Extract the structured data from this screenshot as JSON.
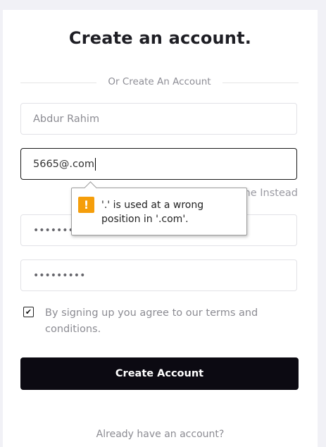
{
  "form": {
    "title": "Create an account.",
    "divider_text": "Or Create An Account",
    "name_value": "Abdur Rahim",
    "email_value": "5665@.com",
    "alt_link": "me Instead",
    "password_dots": "••••••••••",
    "confirm_dots": "•••••••••",
    "terms_text": "By signing up you agree to our terms and conditions.",
    "submit_label": "Create Account",
    "already_text": "Already have an account?"
  },
  "validation_tooltip": {
    "icon": "warning-icon",
    "icon_glyph": "!",
    "message": "'.' is used at a wrong position in '.com'."
  },
  "checkbox": {
    "checked": true,
    "glyph": "✔"
  },
  "colors": {
    "background": "#f1f1f6",
    "button": "#0c0a12",
    "warning": "#f59e0b"
  }
}
